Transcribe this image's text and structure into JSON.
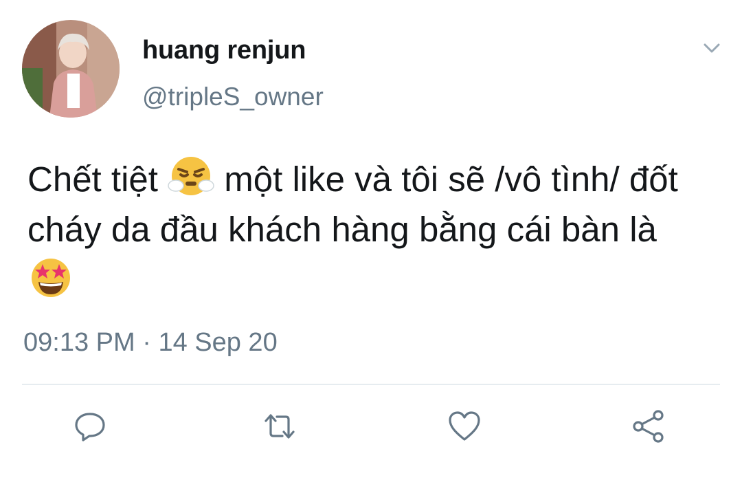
{
  "tweet": {
    "display_name": "huang renjun",
    "handle": "@tripleS_owner",
    "text_part1": "Chết tiệt ",
    "text_part2": " một like và tôi sẽ /vô tình/ đốt cháy da đầu khách hàng bằng cái bàn là ",
    "emoji_1": "face-with-steam-from-nose",
    "emoji_2": "star-struck",
    "time": "09:13 PM",
    "separator": "·",
    "date": "14 Sep 20"
  },
  "icons": {
    "menu": "chevron-down-icon",
    "reply": "reply-icon",
    "retweet": "retweet-icon",
    "like": "heart-icon",
    "share": "share-icon"
  },
  "colors": {
    "text_primary": "#14171a",
    "text_secondary": "#657786",
    "icon": "#657786",
    "divider": "#e6ecf0"
  }
}
